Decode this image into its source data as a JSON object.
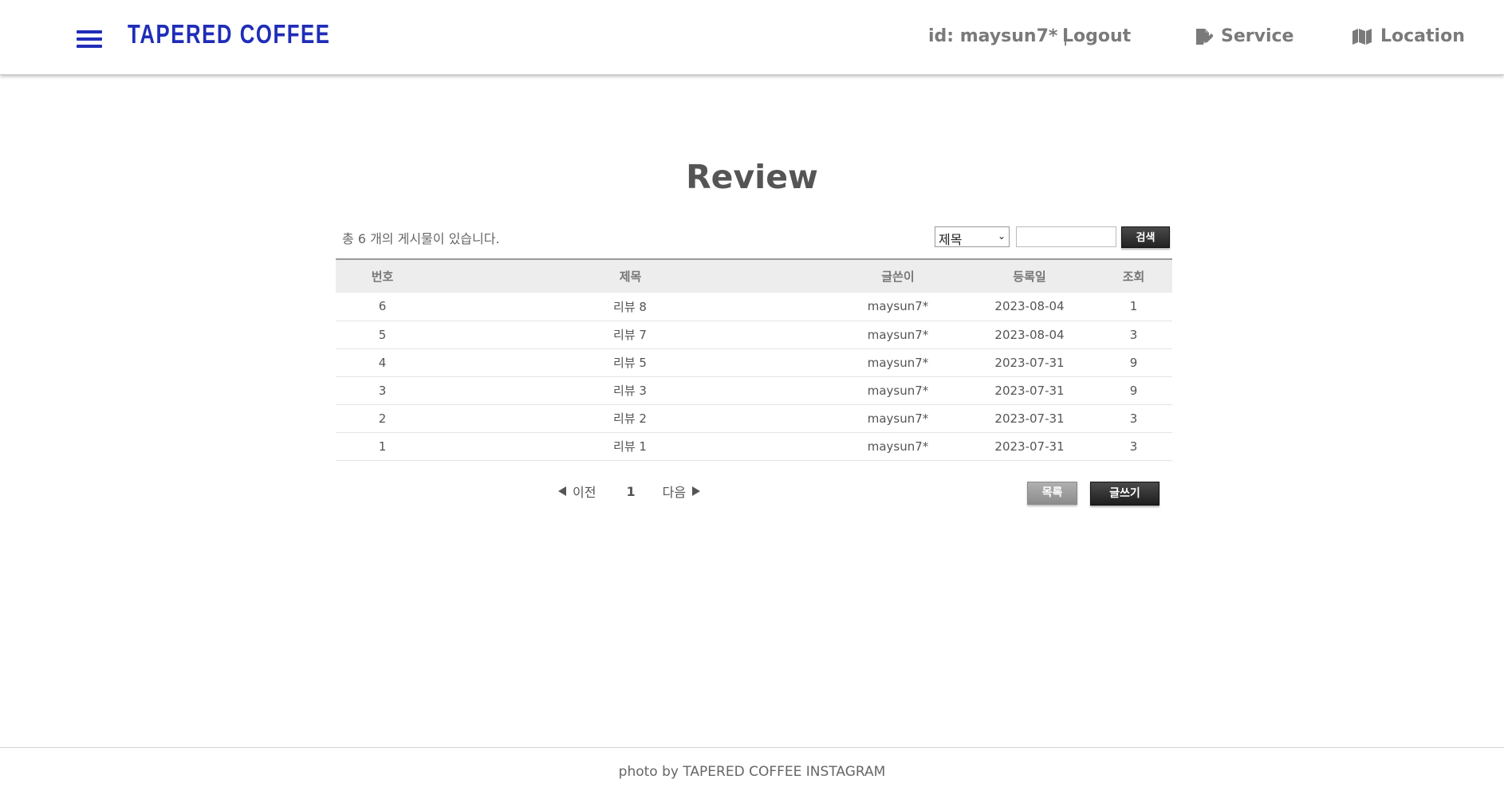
{
  "header": {
    "logo": "TAPERED COFFEE",
    "user_label": "id: maysun7*",
    "separator": "|",
    "logout_label": "Logout",
    "service_label": "Service",
    "location_label": "Location",
    "brand_color": "#1f2db8"
  },
  "board": {
    "title": "Review",
    "count_text": "총 6 개의 게시물이 있습니다.",
    "search_select_value": "제목",
    "search_button": "검색",
    "columns": [
      "번호",
      "제목",
      "글쓴이",
      "등록일",
      "조회"
    ],
    "rows": [
      {
        "no": "6",
        "title": "리뷰 8",
        "writer": "maysun7*",
        "date": "2023-08-04",
        "hits": "1"
      },
      {
        "no": "5",
        "title": "리뷰 7",
        "writer": "maysun7*",
        "date": "2023-08-04",
        "hits": "3"
      },
      {
        "no": "4",
        "title": "리뷰 5",
        "writer": "maysun7*",
        "date": "2023-07-31",
        "hits": "9"
      },
      {
        "no": "3",
        "title": "리뷰 3",
        "writer": "maysun7*",
        "date": "2023-07-31",
        "hits": "9"
      },
      {
        "no": "2",
        "title": "리뷰 2",
        "writer": "maysun7*",
        "date": "2023-07-31",
        "hits": "3"
      },
      {
        "no": "1",
        "title": "리뷰 1",
        "writer": "maysun7*",
        "date": "2023-07-31",
        "hits": "3"
      }
    ],
    "pager": {
      "prev_label": "이전",
      "current_page": "1",
      "next_label": "다음"
    },
    "list_button": "목록",
    "write_button": "글쓰기"
  },
  "footer": {
    "text": "photo by TAPERED COFFEE INSTAGRAM"
  }
}
